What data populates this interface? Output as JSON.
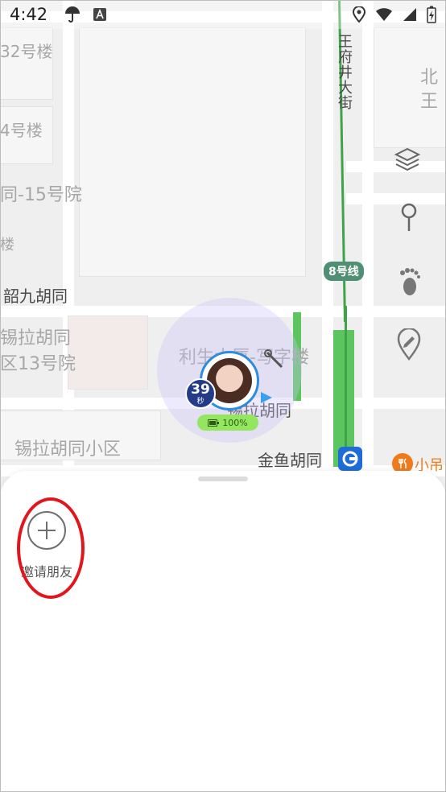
{
  "status_bar": {
    "time": "4:42",
    "left_icons": [
      "umbrella-icon",
      "a-notification-icon"
    ],
    "right_icons": [
      "location-icon",
      "wifi-icon",
      "signal-icon",
      "battery-charging-icon"
    ]
  },
  "map": {
    "labels": {
      "building_32": "32号楼",
      "building_4": "4号楼",
      "courtyard_15": "同-15号院",
      "building_lou": "楼",
      "shaojiu_hutong": "韶九胡同",
      "xila_hutong_13": "锡拉胡同",
      "qu_13": "区13号院",
      "lisheng_dasha": "利生大厦-写字楼",
      "xila_hutong": "锡拉胡同",
      "xila_hutong_xiaoqu": "锡拉胡同小区",
      "jinyu_hutong": "金鱼胡同",
      "wangfujing_dajie": "王府井大街",
      "bei_wang": "北王",
      "xiao": "小吊"
    },
    "metro_line": "8号线",
    "timer": {
      "value": "39",
      "unit": "秒"
    },
    "battery_percent": "100%",
    "controls": [
      "layers-icon",
      "pin-icon",
      "footprint-icon",
      "map-marker-edit-icon"
    ]
  },
  "sheet": {
    "invite_label": "邀请朋友"
  },
  "colors": {
    "annotation": "#e2151c",
    "metro_green": "#3fa34a",
    "timer_bg": "#243b88",
    "battery_pill": "#94e65e"
  }
}
